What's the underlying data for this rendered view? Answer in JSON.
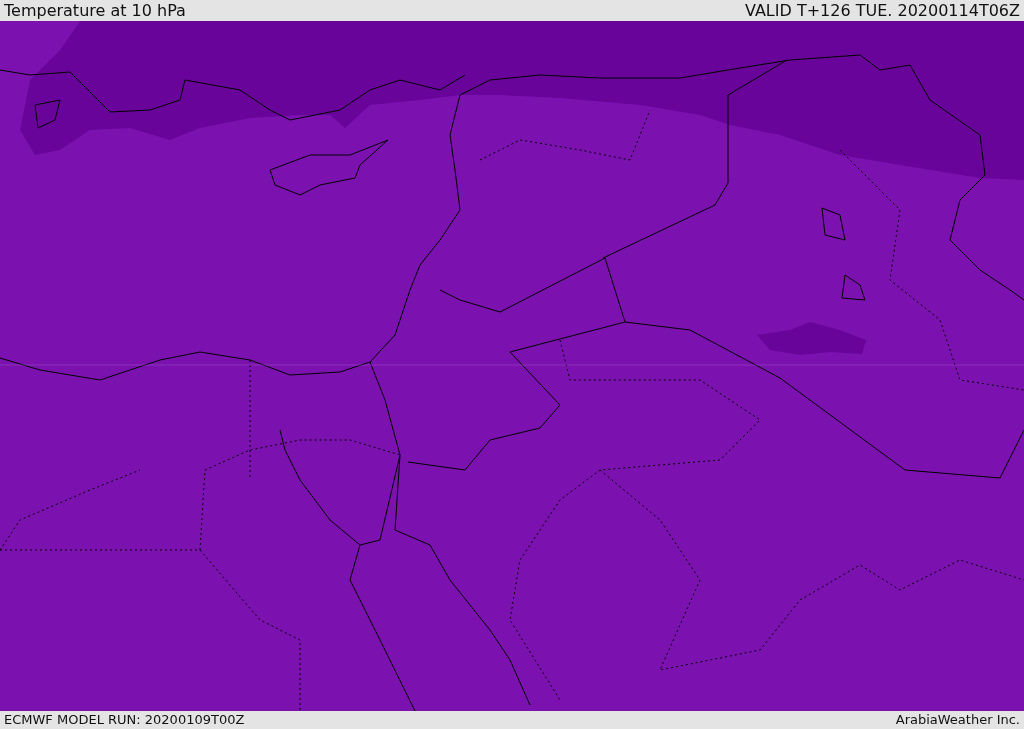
{
  "header": {
    "title": "Temperature at 10 hPa",
    "valid": "VALID T+126 TUE. 20200114T06Z"
  },
  "footer": {
    "model_run": "ECMWF MODEL RUN: 20200109T00Z",
    "credit": "ArabiaWeather Inc."
  }
}
